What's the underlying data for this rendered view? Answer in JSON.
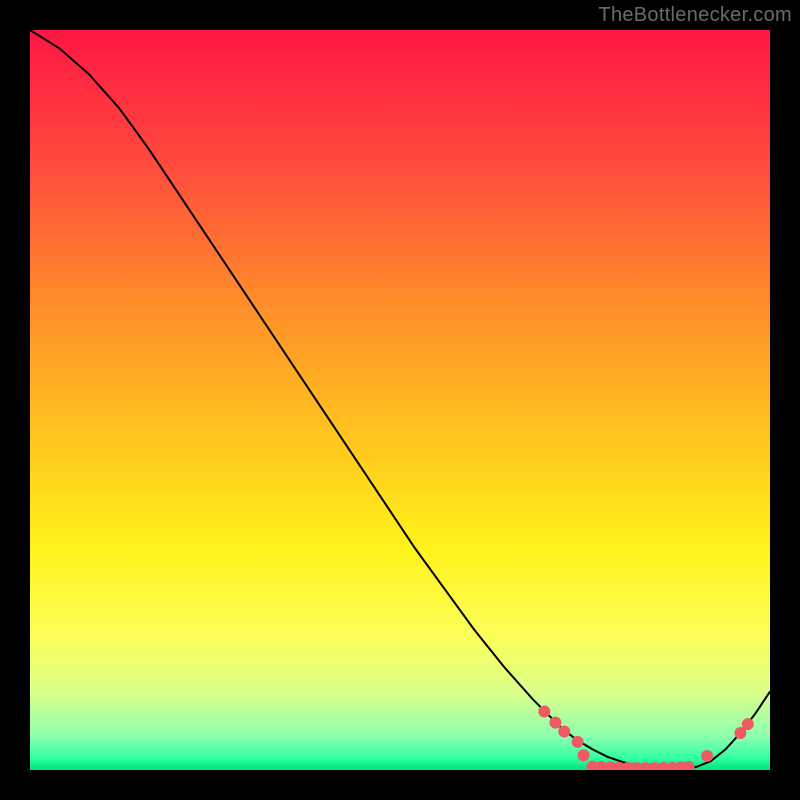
{
  "watermark": "TheBottlenecker.com",
  "chart_data": {
    "type": "line",
    "title": "",
    "xlabel": "",
    "ylabel": "",
    "xlim": [
      0,
      100
    ],
    "ylim": [
      0,
      100
    ],
    "background_gradient": {
      "type": "vertical",
      "stops": [
        {
          "pos": 0.0,
          "color": "#ff1744"
        },
        {
          "pos": 0.18,
          "color": "#ff4a3c"
        },
        {
          "pos": 0.36,
          "color": "#ff8a2b"
        },
        {
          "pos": 0.54,
          "color": "#ffc21e"
        },
        {
          "pos": 0.7,
          "color": "#fff21a"
        },
        {
          "pos": 0.82,
          "color": "#fbff5a"
        },
        {
          "pos": 0.9,
          "color": "#d6ff8c"
        },
        {
          "pos": 0.955,
          "color": "#8bffb0"
        },
        {
          "pos": 0.985,
          "color": "#2dffa0"
        },
        {
          "pos": 1.0,
          "color": "#00e07c"
        }
      ]
    },
    "series": [
      {
        "name": "bottleneck-curve",
        "color": "#000000",
        "width": 2.0,
        "x": [
          0,
          4,
          8,
          12,
          16,
          20,
          24,
          28,
          32,
          36,
          40,
          44,
          48,
          52,
          56,
          60,
          64,
          68,
          72,
          74,
          76,
          78,
          80,
          82,
          84,
          86,
          88,
          90,
          92,
          94,
          96,
          98,
          100
        ],
        "y": [
          100,
          97.5,
          94,
          89.5,
          84,
          78,
          72,
          66,
          60,
          54,
          48,
          42,
          36,
          30,
          24.5,
          19,
          14,
          9.5,
          5.5,
          4,
          2.8,
          1.8,
          1.1,
          0.6,
          0.35,
          0.2,
          0.2,
          0.4,
          1.2,
          2.8,
          5,
          7.6,
          10.6
        ]
      }
    ],
    "markers": {
      "color": "#ef5b63",
      "radius": 6,
      "points": [
        {
          "x": 69.5,
          "y": 7.9
        },
        {
          "x": 71.0,
          "y": 6.4
        },
        {
          "x": 72.2,
          "y": 5.2
        },
        {
          "x": 74.0,
          "y": 3.8
        },
        {
          "x": 74.8,
          "y": 2.0
        },
        {
          "x": 76.0,
          "y": 0.45
        },
        {
          "x": 77.2,
          "y": 0.4
        },
        {
          "x": 78.4,
          "y": 0.35
        },
        {
          "x": 79.6,
          "y": 0.3
        },
        {
          "x": 80.8,
          "y": 0.28
        },
        {
          "x": 82.0,
          "y": 0.25
        },
        {
          "x": 83.2,
          "y": 0.25
        },
        {
          "x": 84.4,
          "y": 0.25
        },
        {
          "x": 85.6,
          "y": 0.28
        },
        {
          "x": 86.8,
          "y": 0.3
        },
        {
          "x": 88.0,
          "y": 0.35
        },
        {
          "x": 89.0,
          "y": 0.4
        },
        {
          "x": 91.5,
          "y": 1.9
        },
        {
          "x": 96.0,
          "y": 5.0
        },
        {
          "x": 97.0,
          "y": 6.2
        }
      ]
    }
  }
}
